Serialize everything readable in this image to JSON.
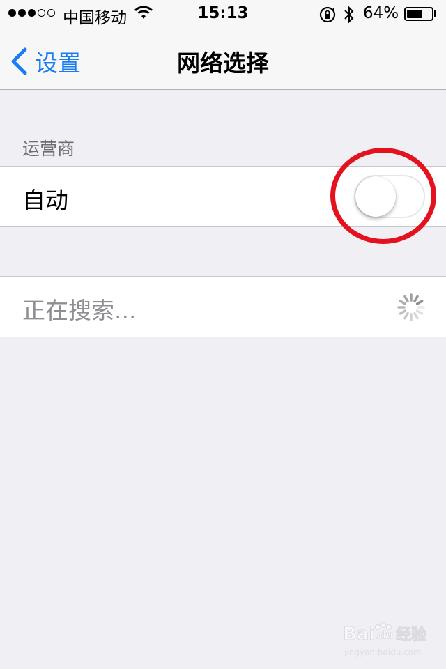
{
  "status_bar": {
    "carrier": "中国移动",
    "time": "15:13",
    "battery_percent": "64%",
    "battery_level": 0.64,
    "signal_bars_filled": 3,
    "signal_bars_total": 5
  },
  "nav": {
    "back_label": "设置",
    "title": "网络选择"
  },
  "carrier_section": {
    "header": "运营商",
    "auto_label": "自动",
    "auto_enabled": false
  },
  "search_row": {
    "label": "正在搜索..."
  },
  "watermark": {
    "brand": "Bai",
    "brand2": "du",
    "text": "经验",
    "url": "jingyan.baidu.com"
  },
  "colors": {
    "accent": "#1a7cf5",
    "background": "#efeff4",
    "annotation_ring": "#e4121e"
  }
}
